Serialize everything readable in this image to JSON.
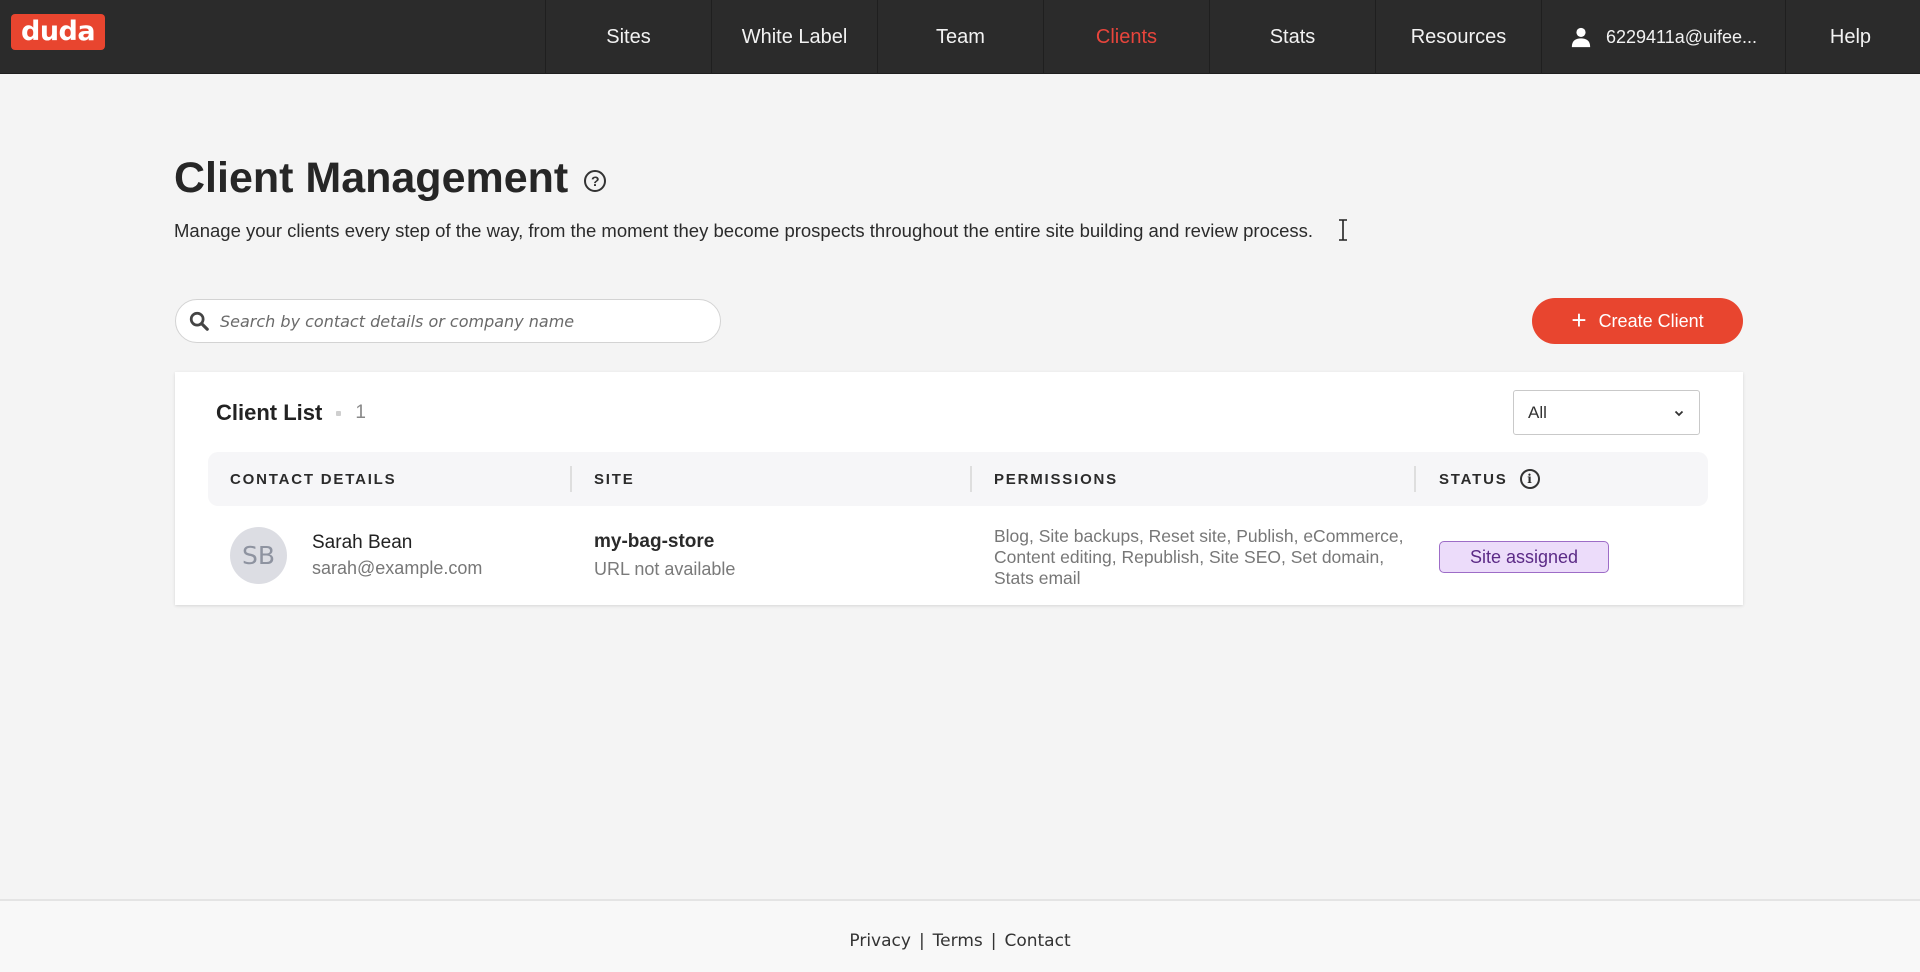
{
  "brand": {
    "logo_text": "duda",
    "accent_color": "#e8452f"
  },
  "nav": {
    "items": [
      {
        "label": "Sites",
        "active": false
      },
      {
        "label": "White Label",
        "active": false
      },
      {
        "label": "Team",
        "active": false
      },
      {
        "label": "Clients",
        "active": true
      },
      {
        "label": "Stats",
        "active": false
      },
      {
        "label": "Resources",
        "active": false
      }
    ],
    "account": {
      "icon": "user-icon",
      "label": "6229411a@uifee..."
    },
    "help_label": "Help"
  },
  "header": {
    "title": "Client Management",
    "help_icon": "question-circle-icon",
    "subtitle": "Manage your clients every step of the way, from the moment they become prospects throughout the entire site building and review process."
  },
  "search": {
    "placeholder": "Search by contact details or company name",
    "value": ""
  },
  "create_button": {
    "label": "Create Client",
    "icon": "plus-icon"
  },
  "client_list": {
    "title": "Client List",
    "count": "1",
    "filter": {
      "selected": "All"
    },
    "columns": [
      "CONTACT DETAILS",
      "SITE",
      "PERMISSIONS",
      "STATUS"
    ],
    "rows": [
      {
        "initials": "SB",
        "name": "Sarah Bean",
        "email": "sarah@example.com",
        "site_name": "my-bag-store",
        "site_url": "URL not available",
        "permissions": "Blog, Site backups, Reset site, Publish, eCommerce, Content editing, Republish, Site SEO, Set domain, Stats email",
        "status": "Site assigned",
        "status_color": "#ecdcfa"
      }
    ]
  },
  "footer": {
    "links": [
      "Privacy",
      "Terms",
      "Contact"
    ],
    "separator": "|"
  }
}
